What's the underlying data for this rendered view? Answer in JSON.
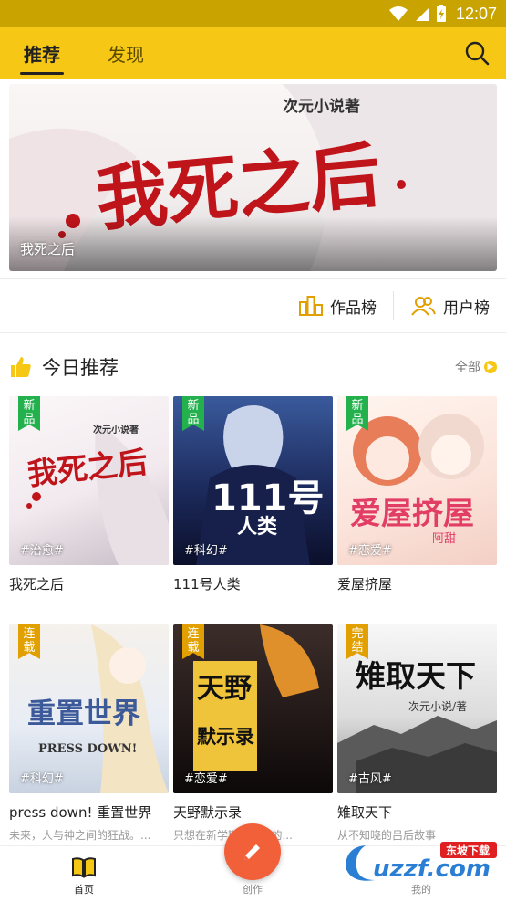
{
  "status_bar": {
    "time": "12:07"
  },
  "header": {
    "tabs": [
      {
        "label": "推荐",
        "active": true
      },
      {
        "label": "发现",
        "active": false
      }
    ]
  },
  "banner": {
    "caption": "我死之后",
    "art_title": "我死之后",
    "publisher_mark": "次元小说著"
  },
  "rankings": {
    "works_label": "作品榜",
    "users_label": "用户榜"
  },
  "section": {
    "title": "今日推荐",
    "see_all": "全部"
  },
  "books": [
    {
      "title": "我死之后",
      "badge": "新品",
      "tag": "#治愈#",
      "desc": ""
    },
    {
      "title": "111号人类",
      "badge": "新品",
      "tag": "#科幻#",
      "desc": ""
    },
    {
      "title": "爱屋挤屋",
      "badge": "新品",
      "tag": "#恋爱#",
      "desc": ""
    },
    {
      "title": "press down! 重置世界",
      "badge": "连载",
      "tag": "#科幻#",
      "desc": "未来，人与神之间的狂战。..."
    },
    {
      "title": "天野默示录",
      "badge": "连载",
      "tag": "#恋爱#",
      "desc": "只想在新学期...生活的..."
    },
    {
      "title": "雉取天下",
      "badge": "完结",
      "tag": "#古风#",
      "desc": "从不知晓的吕后故事"
    }
  ],
  "cover_art": {
    "book1": {
      "line1": "我死之后",
      "line2": "次元小说著"
    },
    "book2": {
      "line1": "111号",
      "line2": "人类"
    },
    "book3": {
      "line1": "爱屋挤屋",
      "line2": "阿甜"
    },
    "book4": {
      "line1": "重置世界",
      "line2": "PRESS DOWN!"
    },
    "book5": {
      "line1": "天野",
      "line2": "默示录"
    },
    "book6": {
      "line1": "雉取天下",
      "line2": "次元小说/著"
    }
  },
  "bottom_nav": {
    "home": "首页",
    "create": "创作",
    "mine": "我的"
  },
  "watermark": {
    "text": "uzzf.com",
    "sub": "东坡下载"
  },
  "colors": {
    "accent": "#f6c714",
    "fab": "#f2603a",
    "badge_new": "#22b14c",
    "badge_serial": "#e2a000"
  }
}
